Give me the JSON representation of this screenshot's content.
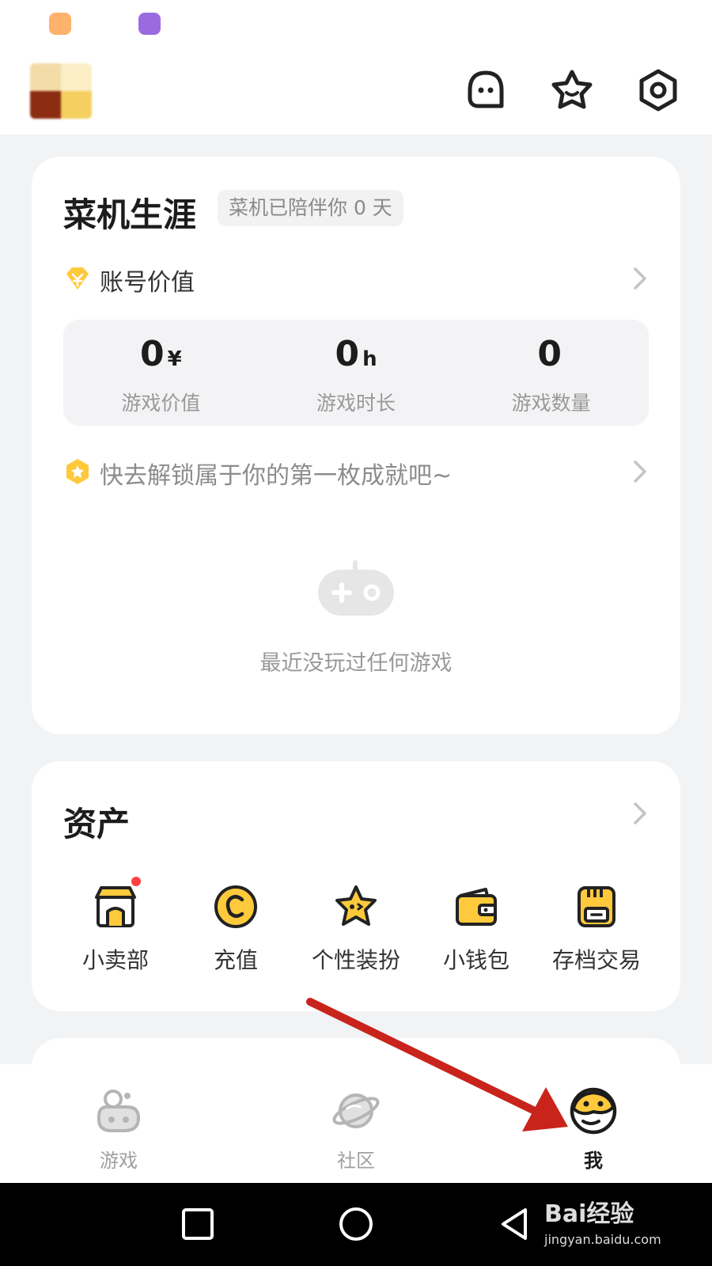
{
  "status_bar": {
    "apps": [
      "app-icon-orange",
      "app-icon-purple"
    ]
  },
  "header": {
    "icons": [
      "message-icon",
      "star-icon",
      "settings-icon"
    ]
  },
  "career": {
    "title": "菜机生涯",
    "badge": "菜机已陪伴你 0 天",
    "account_value_label": "账号价值",
    "stats": [
      {
        "value": "0",
        "unit": "¥",
        "label": "游戏价值"
      },
      {
        "value": "0",
        "unit": "h",
        "label": "游戏时长"
      },
      {
        "value": "0",
        "unit": "",
        "label": "游戏数量"
      }
    ],
    "achievement_prompt": "快去解锁属于你的第一枚成就吧~",
    "empty_text": "最近没玩过任何游戏"
  },
  "assets": {
    "title": "资产",
    "items": [
      {
        "label": "小卖部",
        "icon": "shop-icon",
        "has_dot": true
      },
      {
        "label": "充值",
        "icon": "coin-icon"
      },
      {
        "label": "个性装扮",
        "icon": "dress-up-star-icon"
      },
      {
        "label": "小钱包",
        "icon": "wallet-icon"
      },
      {
        "label": "存档交易",
        "icon": "save-file-icon"
      }
    ]
  },
  "tabs": [
    {
      "label": "游戏",
      "icon": "game-planet-icon",
      "active": false
    },
    {
      "label": "社区",
      "icon": "community-planet-icon",
      "active": false
    },
    {
      "label": "我",
      "icon": "me-face-icon",
      "active": true
    }
  ],
  "watermark": {
    "main": "Bai经验",
    "sub": "jingyan.baidu.com"
  },
  "colors": {
    "accent": "#ffc93c",
    "arrow": "#c8241c",
    "page_bg": "#f2f3f5"
  }
}
